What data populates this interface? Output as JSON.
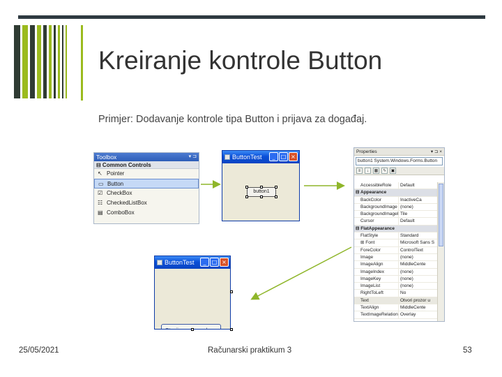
{
  "slide": {
    "title": "Kreiranje kontrole Button",
    "subtitle": "Primjer: Dodavanje kontrole tipa Button i prijava za događaj.",
    "footer": {
      "date": "25/05/2021",
      "course": "Računarski praktikum 3",
      "page": "53"
    },
    "colors": {
      "accent": "#9bbb1e",
      "rule": "#2e3a41",
      "arrow": "#8fb62a"
    }
  },
  "toolbox": {
    "title": "Toolbox",
    "group": "⊟ Common Controls",
    "items": [
      {
        "label": "Pointer",
        "icon": "pointer-icon"
      },
      {
        "label": "Button",
        "icon": "button-icon"
      },
      {
        "label": "CheckBox",
        "icon": "checkbox-icon"
      },
      {
        "label": "CheckedListBox",
        "icon": "checkedlistbox-icon"
      },
      {
        "label": "ComboBox",
        "icon": "combobox-icon"
      }
    ]
  },
  "designer": {
    "window_title": "ButtonTest",
    "button_label": "button1"
  },
  "properties": {
    "title": "Properties",
    "selector": "button1 System.Windows.Forms.Button",
    "rows": [
      {
        "name": "AccessibleRole",
        "value": "Default"
      },
      {
        "name": "⊟ Appearance",
        "value": "",
        "category": true
      },
      {
        "name": "BackColor",
        "value": "InactiveCa"
      },
      {
        "name": "BackgroundImage",
        "value": "(none)"
      },
      {
        "name": "BackgroundImageLa",
        "value": "Tile"
      },
      {
        "name": "Cursor",
        "value": "Default"
      },
      {
        "name": "⊟ FlatAppearance",
        "value": "",
        "category": true
      },
      {
        "name": "FlatStyle",
        "value": "Standard"
      },
      {
        "name": "⊞ Font",
        "value": "Microsoft Sans S"
      },
      {
        "name": "ForeColor",
        "value": "ControlText"
      },
      {
        "name": "Image",
        "value": "(none)"
      },
      {
        "name": "ImageAlign",
        "value": "MiddleCente"
      },
      {
        "name": "ImageIndex",
        "value": "(none)"
      },
      {
        "name": "ImageKey",
        "value": "(none)"
      },
      {
        "name": "ImageList",
        "value": "(none)"
      },
      {
        "name": "RightToLeft",
        "value": "No"
      },
      {
        "name": "Text",
        "value": "Otvori prozor u"
      },
      {
        "name": "TextAlign",
        "value": "MiddleCente"
      },
      {
        "name": "TextImageRelation",
        "value": "Overlay"
      }
    ]
  },
  "runtime": {
    "window_title": "ButtonTest",
    "button_label": "Otvoji prozor u zelcno."
  }
}
